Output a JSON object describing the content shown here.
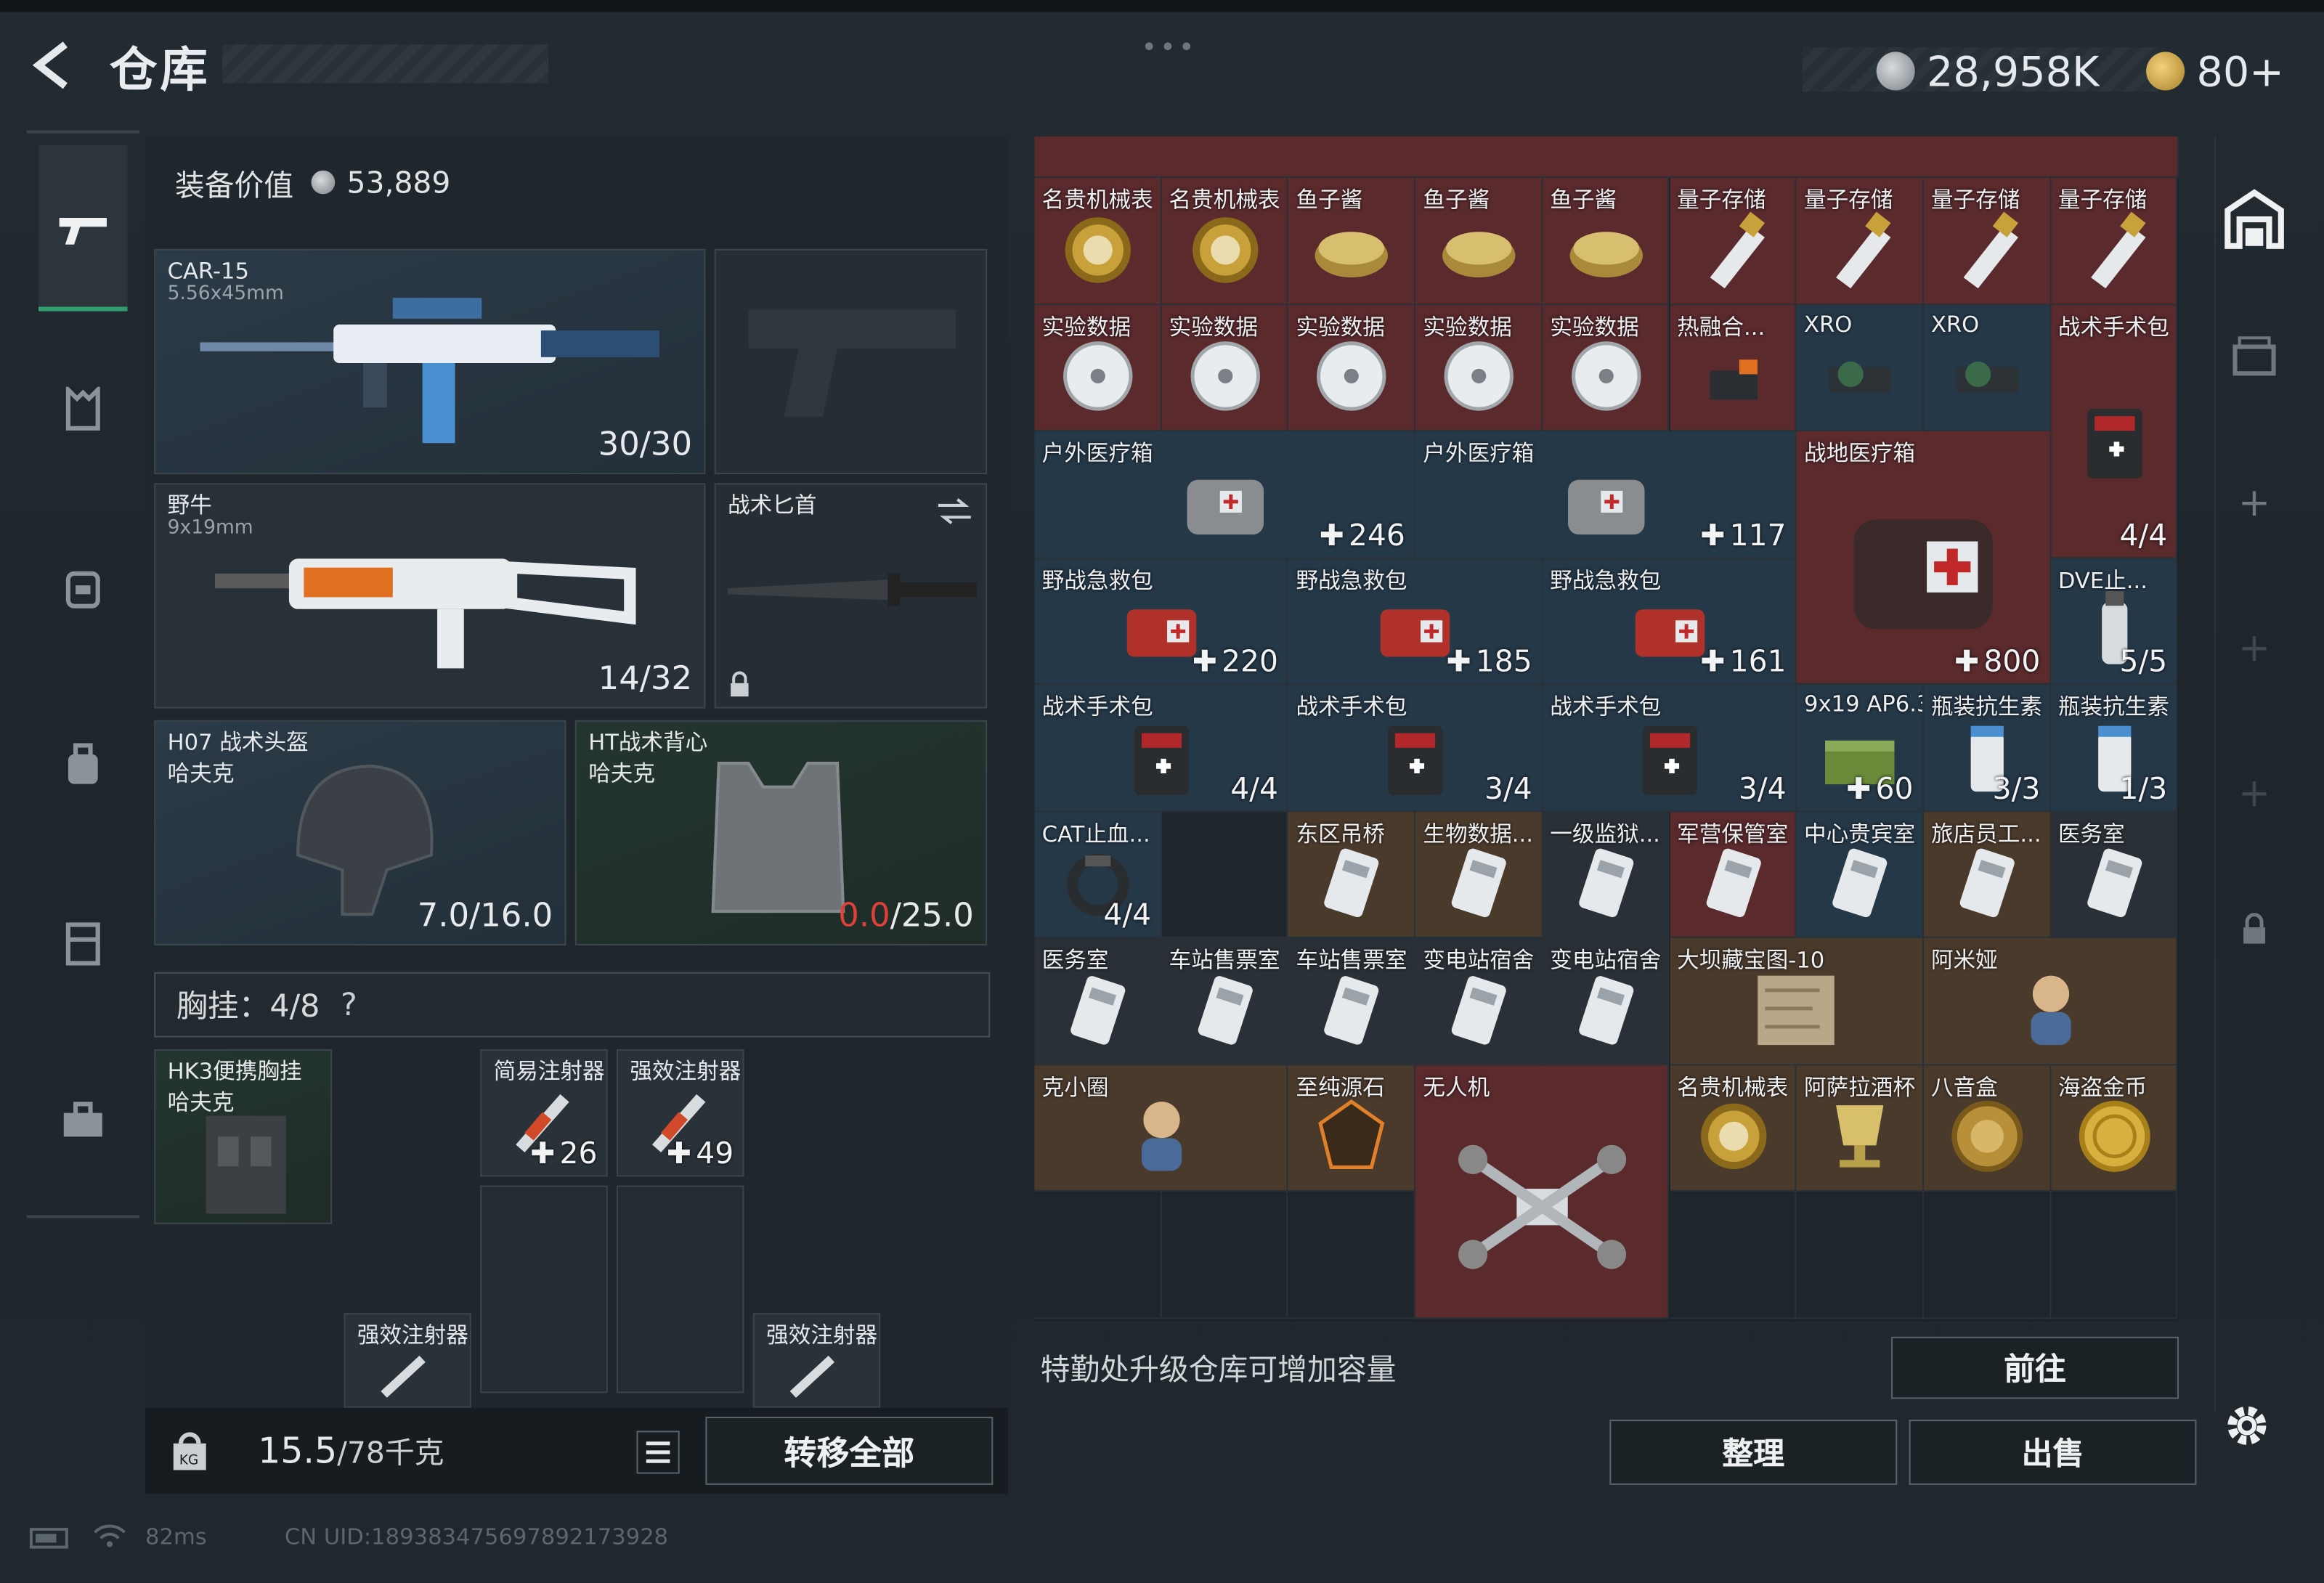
{
  "header": {
    "title": "仓库",
    "currency_silver": "28,958K",
    "currency_gold": "80+"
  },
  "loadout": {
    "equip_value_label": "装备价值",
    "equip_value": "53,889",
    "primary": {
      "name": "CAR-15",
      "caliber": "5.56x45mm",
      "ammo": "30/30"
    },
    "secondary_empty": "",
    "weapon2": {
      "name": "野牛",
      "caliber": "9x19mm",
      "ammo": "14/32"
    },
    "melee": {
      "name": "战术匕首"
    },
    "helmet": {
      "name": "H07 战术头盔",
      "brand": "哈夫克",
      "durability": "7.0/16.0"
    },
    "armor": {
      "name": "HT战术背心",
      "brand": "哈夫克",
      "durability_current": "0.0",
      "durability_max": "/25.0"
    },
    "chest_label": "胸挂：4/8",
    "chest_help": "?",
    "rig": {
      "name": "HK3便携胸挂",
      "brand": "哈夫克"
    },
    "inj1": {
      "name": "简易注射器",
      "qty": "26"
    },
    "inj2": {
      "name": "强效注射器",
      "qty": "49"
    },
    "inj3": {
      "name": "强效注射器"
    },
    "inj4": {
      "name": "强效注射器"
    },
    "weight": "15.5",
    "weight_max": "/78千克",
    "transfer_all": "转移全部"
  },
  "inventory": {
    "upgrade_hint": "特勤处升级仓库可增加容量",
    "goto": "前往",
    "sort": "整理",
    "sell": "出售",
    "cells": [
      {
        "label": "名贵机械表",
        "qty": "",
        "icon": "watch-icon"
      },
      {
        "label": "名贵机械表",
        "qty": "",
        "icon": "watch-icon"
      },
      {
        "label": "鱼子酱",
        "qty": "",
        "icon": "caviar-icon"
      },
      {
        "label": "鱼子酱",
        "qty": "",
        "icon": "caviar-icon"
      },
      {
        "label": "鱼子酱",
        "qty": "",
        "icon": "caviar-icon"
      },
      {
        "label": "量子存储",
        "qty": "",
        "icon": "usb-icon"
      },
      {
        "label": "量子存储",
        "qty": "",
        "icon": "usb-icon"
      },
      {
        "label": "量子存储",
        "qty": "",
        "icon": "usb-icon"
      },
      {
        "label": "量子存储",
        "qty": "",
        "icon": "usb-icon"
      },
      {
        "label": "实验数据",
        "qty": "",
        "icon": "disc-icon"
      },
      {
        "label": "实验数据",
        "qty": "",
        "icon": "disc-icon"
      },
      {
        "label": "实验数据",
        "qty": "",
        "icon": "disc-icon"
      },
      {
        "label": "实验数据",
        "qty": "",
        "icon": "disc-icon"
      },
      {
        "label": "实验数据",
        "qty": "",
        "icon": "disc-icon"
      },
      {
        "label": "热融合...",
        "qty": "",
        "icon": "device-icon"
      },
      {
        "label": "XRO",
        "qty": "",
        "icon": "scope-icon"
      },
      {
        "label": "XRO",
        "qty": "",
        "icon": "scope-icon"
      },
      {
        "label": "战术手术包",
        "qty": "4/4",
        "icon": "surgery-kit-icon"
      },
      {
        "label": "户外医疗箱",
        "qty": "246",
        "icon": "medkit-bag-icon"
      },
      {
        "label": "户外医疗箱",
        "qty": "117",
        "icon": "medkit-bag-icon"
      },
      {
        "label": "战地医疗箱",
        "qty": "800",
        "icon": "first-aid-case-icon"
      },
      {
        "label": "野战急救包",
        "qty": "220",
        "icon": "first-aid-icon"
      },
      {
        "label": "野战急救包",
        "qty": "185",
        "icon": "first-aid-icon"
      },
      {
        "label": "野战急救包",
        "qty": "161",
        "icon": "first-aid-icon"
      },
      {
        "label": "DVE止...",
        "qty": "5/5",
        "icon": "spray-icon"
      },
      {
        "label": "战术手术包",
        "qty": "4/4",
        "icon": "surgery-kit-icon"
      },
      {
        "label": "战术手术包",
        "qty": "3/4",
        "icon": "surgery-kit-icon"
      },
      {
        "label": "战术手术包",
        "qty": "3/4",
        "icon": "surgery-kit-icon"
      },
      {
        "label": "9x19 AP6.3",
        "qty": "60",
        "icon": "ammo-box-icon"
      },
      {
        "label": "瓶装抗生素",
        "qty": "3/3",
        "icon": "pill-bottle-icon"
      },
      {
        "label": "瓶装抗生素",
        "qty": "1/3",
        "icon": "pill-bottle-icon"
      },
      {
        "label": "CAT止血...",
        "qty": "4/4",
        "icon": "tourniquet-icon"
      },
      {
        "label": "东区吊桥",
        "qty": "",
        "icon": "key-card-icon"
      },
      {
        "label": "生物数据...",
        "qty": "",
        "icon": "key-card-icon"
      },
      {
        "label": "一级监狱...",
        "qty": "",
        "icon": "key-card-icon"
      },
      {
        "label": "军营保管室",
        "qty": "",
        "icon": "key-card-icon"
      },
      {
        "label": "中心贵宾室",
        "qty": "",
        "icon": "key-card-icon"
      },
      {
        "label": "旅店员工...",
        "qty": "",
        "icon": "key-card-icon"
      },
      {
        "label": "医务室",
        "qty": "",
        "icon": "key-card-icon"
      },
      {
        "label": "医务室",
        "qty": "",
        "icon": "key-card-icon"
      },
      {
        "label": "车站售票室",
        "qty": "",
        "icon": "key-card-icon"
      },
      {
        "label": "车站售票室",
        "qty": "",
        "icon": "key-card-icon"
      },
      {
        "label": "变电站宿舍",
        "qty": "",
        "icon": "key-card-icon"
      },
      {
        "label": "变电站宿舍",
        "qty": "",
        "icon": "key-card-icon"
      },
      {
        "label": "大坝藏宝图-10",
        "qty": "",
        "icon": "map-icon"
      },
      {
        "label": "阿米娅",
        "qty": "",
        "icon": "figurine-icon"
      },
      {
        "label": "克小圈",
        "qty": "",
        "icon": "figurine-icon"
      },
      {
        "label": "至纯源石",
        "qty": "",
        "icon": "gem-icon"
      },
      {
        "label": "无人机",
        "qty": "",
        "icon": "drone-icon"
      },
      {
        "label": "名贵机械表",
        "qty": "",
        "icon": "watch-icon"
      },
      {
        "label": "阿萨拉酒杯",
        "qty": "",
        "icon": "cup-icon"
      },
      {
        "label": "八音盒",
        "qty": "",
        "icon": "music-box-icon"
      },
      {
        "label": "海盗金币",
        "qty": "",
        "icon": "coin-icon"
      }
    ]
  },
  "footer": {
    "ping": "82ms",
    "uid": "CN UID:18938347569789217392​8"
  }
}
